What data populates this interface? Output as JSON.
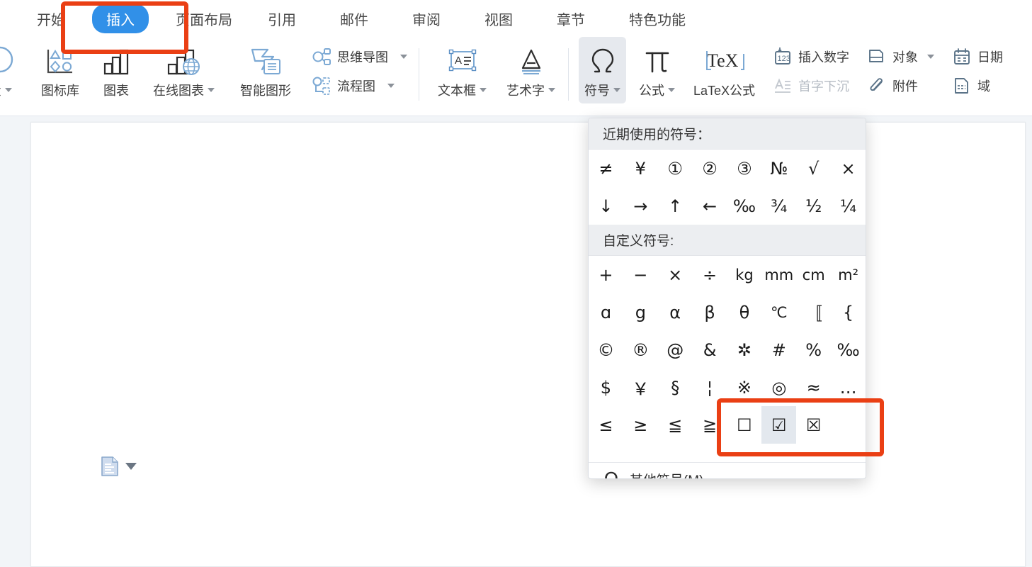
{
  "tabs": [
    {
      "label": "开始",
      "active": false
    },
    {
      "label": "插入",
      "active": true
    },
    {
      "label": "页面布局",
      "active": false
    },
    {
      "label": "引用",
      "active": false
    },
    {
      "label": "邮件",
      "active": false
    },
    {
      "label": "审阅",
      "active": false
    },
    {
      "label": "视图",
      "active": false
    },
    {
      "label": "章节",
      "active": false
    },
    {
      "label": "特色功能",
      "active": false
    }
  ],
  "ribbon": {
    "shapes_label": "状",
    "icon_library_label": "图标库",
    "chart_label": "图表",
    "online_chart_label": "在线图表",
    "smart_graphic_label": "智能图形",
    "mindmap_label": "思维导图",
    "flowchart_label": "流程图",
    "textbox_label": "文本框",
    "wordart_label": "艺术字",
    "symbol_label": "符号",
    "formula_label": "公式",
    "latex_label": "LaTeX公式",
    "insert_number_label": "插入数字",
    "drop_cap_label": "首字下沉",
    "object_label": "对象",
    "attachment_label": "附件",
    "date_label": "日期",
    "field_label": "域"
  },
  "dropdown": {
    "recent_header": "近期使用的符号：",
    "recent_symbols": [
      "≠",
      "¥",
      "①",
      "②",
      "③",
      "№",
      "√",
      "×",
      "↓",
      "→",
      "↑",
      "←",
      "‰",
      "¾",
      "½",
      "¼"
    ],
    "custom_header": "自定义符号:",
    "custom_symbols": [
      "+",
      "−",
      "×",
      "÷",
      "kg",
      "mm",
      "cm",
      "m²",
      "ɑ",
      "g",
      "α",
      "β",
      "θ",
      "℃",
      "〚",
      "{",
      "©",
      "®",
      "@",
      "&",
      "✲",
      "#",
      "%",
      "‰",
      "$",
      "￥",
      "§",
      "¦",
      "※",
      "◎",
      "≈",
      "…",
      "≤",
      "≥",
      "≦",
      "≧",
      "☐",
      "☑",
      "☒",
      ""
    ],
    "selected_symbol_index": 37,
    "more_symbols_label": "其他符号(M)…"
  },
  "colors": {
    "accent": "#3190e8",
    "annotation": "#ea3f14",
    "icon_blue": "#7ca9d4",
    "panel_header_bg": "#eceef1",
    "selected_cell_bg": "#e3e8ee"
  },
  "annotations": [
    {
      "name": "insert-tab-highlight"
    },
    {
      "name": "checkbox-symbols-highlight"
    }
  ]
}
